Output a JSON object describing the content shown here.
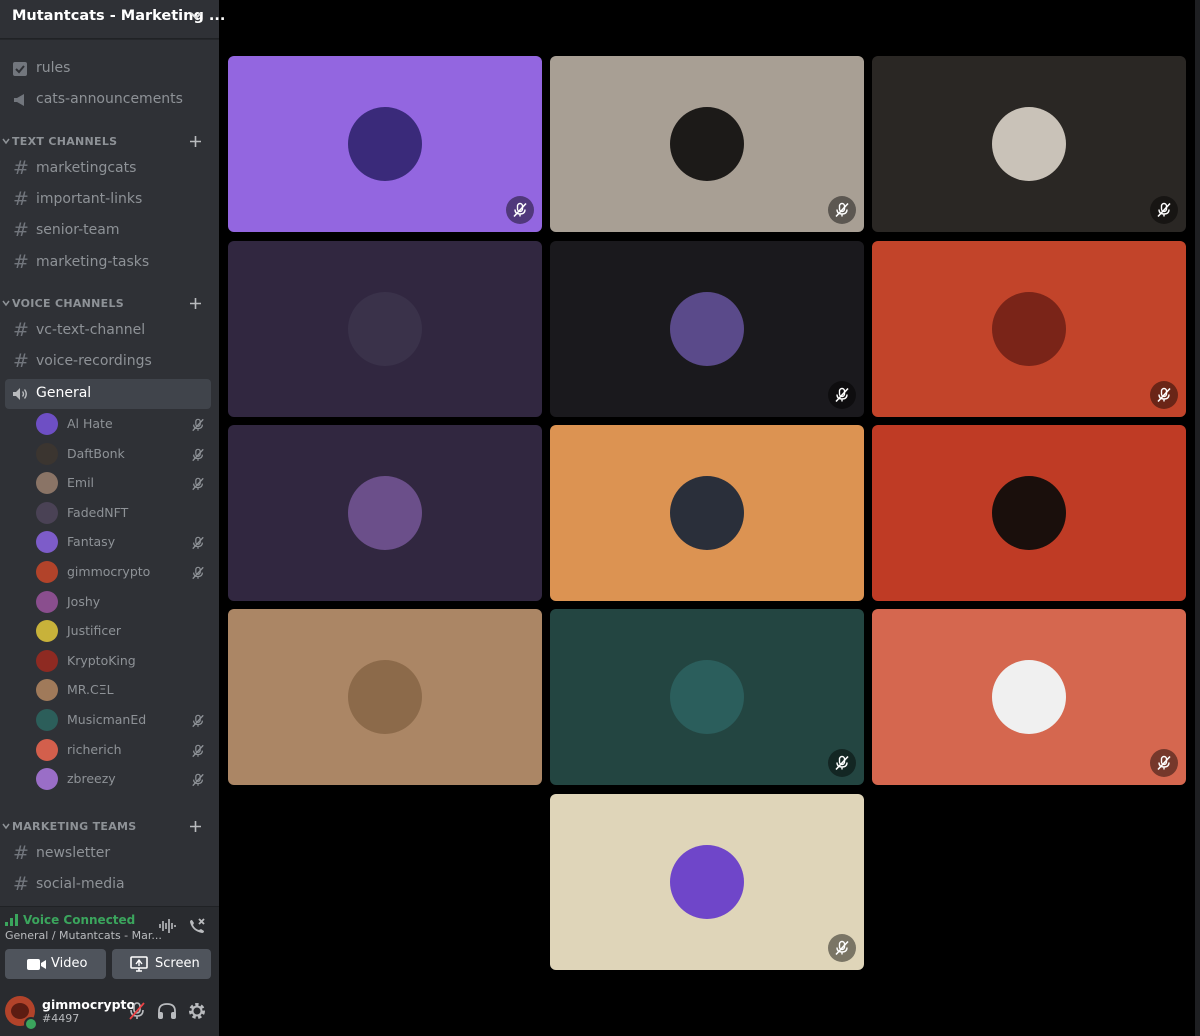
{
  "server": {
    "name": "Mutantcats - Marketing ..."
  },
  "channels_top": [
    {
      "icon": "rules-icon",
      "label": "rules"
    },
    {
      "icon": "announcement-icon",
      "label": "cats-announcements"
    }
  ],
  "categories": [
    {
      "label": "TEXT CHANNELS",
      "channels": [
        "marketingcats",
        "important-links",
        "senior-team",
        "marketing-tasks"
      ]
    },
    {
      "label": "VOICE CHANNELS",
      "channels": [
        "vc-text-channel",
        "voice-recordings"
      ],
      "voice_channel": "General"
    },
    {
      "label": "MARKETING TEAMS",
      "channels": [
        "newsletter",
        "social-media"
      ]
    }
  ],
  "voice_users": [
    {
      "name": "Al Hate",
      "muted": true,
      "color": "#6e4fc4"
    },
    {
      "name": "DaftBonk",
      "muted": true,
      "color": "#3b3530"
    },
    {
      "name": "Emil",
      "muted": true,
      "color": "#8a7466"
    },
    {
      "name": "FadedNFT",
      "muted": false,
      "color": "#4a4255"
    },
    {
      "name": "Fantasy",
      "muted": true,
      "color": "#7d5cc9"
    },
    {
      "name": "gimmocrypto",
      "muted": true,
      "color": "#b2432a"
    },
    {
      "name": "Joshy",
      "muted": false,
      "color": "#8a4e8e"
    },
    {
      "name": "Justificer",
      "muted": false,
      "color": "#c8b23a"
    },
    {
      "name": "KryptoKing",
      "muted": false,
      "color": "#8e2a22"
    },
    {
      "name": "MR.CΞL",
      "muted": false,
      "color": "#a07a5a"
    },
    {
      "name": "MusicmanEd",
      "muted": true,
      "color": "#2c5e5a"
    },
    {
      "name": "richerich",
      "muted": true,
      "color": "#d35f4c"
    },
    {
      "name": "zbreezy",
      "muted": true,
      "color": "#9a6ec7"
    }
  ],
  "voice_panel": {
    "status": "Voice Connected",
    "location": "General / Mutantcats - Mar...",
    "video_label": "Video",
    "screen_label": "Screen"
  },
  "user": {
    "name": "gimmocrypto",
    "tag": "#4497"
  },
  "tiles": [
    {
      "bg": "#9366e0",
      "avatar": "#3a2a7a",
      "muted": true
    },
    {
      "bg": "#a89f94",
      "avatar": "#1c1a18",
      "muted": true
    },
    {
      "bg": "#2a2724",
      "avatar": "#c9c2b8",
      "muted": true
    },
    {
      "bg": "#312740",
      "avatar": "#3a324a",
      "muted": false
    },
    {
      "bg": "#1a191d",
      "avatar": "#5a4a8a",
      "muted": true
    },
    {
      "bg": "#c2442a",
      "avatar": "#7a2418",
      "muted": true
    },
    {
      "bg": "#312740",
      "avatar": "#6b4f8a",
      "muted": false
    },
    {
      "bg": "#dc9352",
      "avatar": "#2a2f3a",
      "muted": false
    },
    {
      "bg": "#bf3b25",
      "avatar": "#1a0f0c",
      "muted": false
    },
    {
      "bg": "#ab8665",
      "avatar": "#8c6a4a",
      "muted": false
    },
    {
      "bg": "#234541",
      "avatar": "#2b5e5c",
      "muted": true
    },
    {
      "bg": "#d5674f",
      "avatar": "#f0f0f0",
      "muted": true
    },
    {
      "bg": "#dfd5b9",
      "avatar": "#6f46c9",
      "muted": true
    }
  ]
}
